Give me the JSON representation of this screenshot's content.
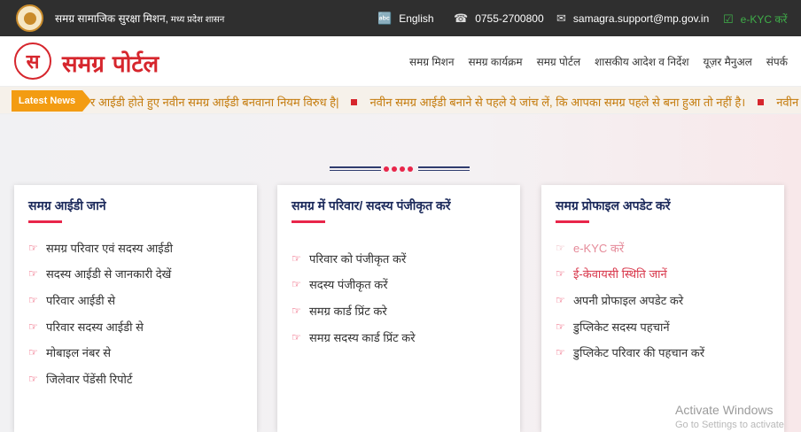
{
  "topbar": {
    "org": "समग्र सामाजिक सुरक्षा मिशन,",
    "org_sub": " मध्य प्रदेश शासन",
    "language": "English",
    "phone": "0755-2700800",
    "email": "samagra.support@mp.gov.in",
    "ekyc": "e-KYC करें"
  },
  "header": {
    "logo_letter": "स",
    "logo_text": "समग्र पोर्टल",
    "nav": [
      "समग्र मिशन",
      "समग्र कार्यक्रम",
      "समग्र पोर्टल",
      "शासकीय आदेश व निर्देश",
      "यूज़र मैनुअल",
      "संपर्क"
    ]
  },
  "ticker": {
    "label": "Latest News",
    "items": [
      "र आईडी होते हुए नवीन समग्र आईडी बनवाना नियम विरुध है|",
      "नवीन समग्र आईडी बनाने से पहले ये जांच लें, कि आपका समग्र पहले से बना हुआ तो नहीं है।",
      "नवीन स"
    ]
  },
  "cards": [
    {
      "title": "समग्र आईडी जाने",
      "items": [
        "समग्र परिवार एवं सदस्य आईडी",
        "सदस्य आईडी से जानकारी देखें",
        "परिवार आईडी से",
        "परिवार सदस्य आईडी से",
        "मोबाइल नंबर से",
        "जिलेवार पेंडेंसी रिपोर्ट"
      ]
    },
    {
      "title": "समग्र में परिवार/ सदस्य पंजीकृत करें",
      "items": [
        "परिवार को पंजीकृत करें",
        "सदस्य पंजीकृत करें",
        "समग्र कार्ड प्रिंट करे",
        "समग्र सदस्य कार्ड प्रिंट करे"
      ]
    },
    {
      "title": "समग्र प्रोफाइल अपडेट करें",
      "items": [
        "e-KYC करें",
        "ई-केवायसी स्थिति जानें",
        "अपनी प्रोफाइल अपडेट करे",
        "डुप्लिकेट सदस्य पहचानें",
        "डुप्लिकेट परिवार की पहचान करें"
      ]
    }
  ],
  "watermark": {
    "title": "Activate Windows",
    "subtitle": "Go to Settings to activate"
  },
  "colors": {
    "brand_red": "#d6262d",
    "accent_pink": "#e8264a",
    "navy": "#1d2b5c",
    "ticker_orange": "#f39c12"
  }
}
